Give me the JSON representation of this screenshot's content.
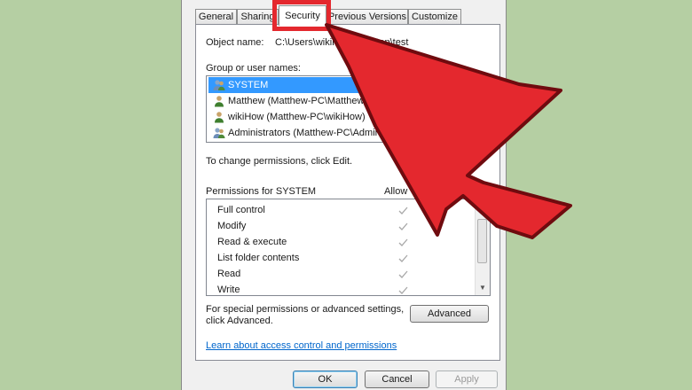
{
  "tabs": [
    {
      "label": "General",
      "active": false
    },
    {
      "label": "Sharing",
      "active": false
    },
    {
      "label": "Security",
      "active": true
    },
    {
      "label": "Previous Versions",
      "active": false
    },
    {
      "label": "Customize",
      "active": false
    }
  ],
  "object": {
    "label": "Object name:",
    "value": "C:\\Users\\wikiHow\\Desktop\\test"
  },
  "groups": {
    "label": "Group or user names:",
    "items": [
      {
        "name": "SYSTEM",
        "selected": true,
        "icon": "users-group-icon"
      },
      {
        "name": "Matthew (Matthew-PC\\Matthew)",
        "selected": false,
        "icon": "user-icon"
      },
      {
        "name": "wikiHow (Matthew-PC\\wikiHow)",
        "selected": false,
        "icon": "user-icon"
      },
      {
        "name": "Administrators (Matthew-PC\\Administrators)",
        "selected": false,
        "icon": "users-group-icon"
      }
    ]
  },
  "change_text": "To change permissions, click Edit.",
  "permissions": {
    "label": "Permissions for SYSTEM",
    "allow_label": "Allow",
    "items": [
      {
        "name": "Full control",
        "allow": true
      },
      {
        "name": "Modify",
        "allow": true
      },
      {
        "name": "Read & execute",
        "allow": true
      },
      {
        "name": "List folder contents",
        "allow": true
      },
      {
        "name": "Read",
        "allow": true
      },
      {
        "name": "Write",
        "allow": true
      }
    ]
  },
  "special": {
    "line1": "For special permissions or advanced settings,",
    "line2": "click Advanced.",
    "button": "Advanced"
  },
  "learn_link": "Learn about access control and permissions",
  "footer": {
    "ok": "OK",
    "cancel": "Cancel",
    "apply": "Apply"
  },
  "colors": {
    "annotation": "#e4282e",
    "background": "#b5cfa3",
    "selection": "#3399ff"
  }
}
